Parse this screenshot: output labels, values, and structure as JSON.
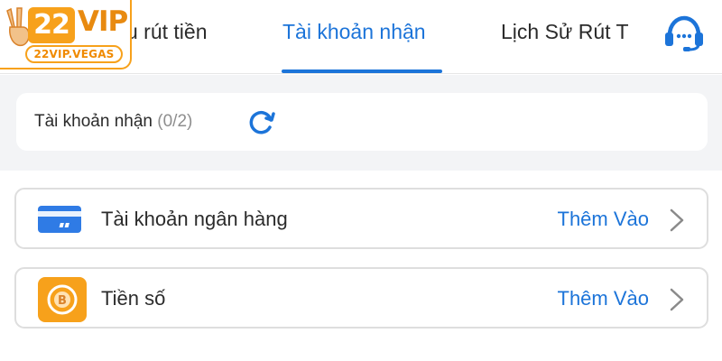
{
  "logo": {
    "badge": "22",
    "text": "VIP",
    "domain": "22VIP.VEGAS"
  },
  "tabs": [
    {
      "label": "u rút tiền",
      "active": false
    },
    {
      "label": "Tài khoản nhận",
      "active": true
    },
    {
      "label": "Lịch Sử Rút T",
      "active": false
    }
  ],
  "support_icon": "headset-icon",
  "summary": {
    "label": "Tài khoản nhận",
    "count": "(0/2)",
    "icon": "refresh-icon"
  },
  "accounts": [
    {
      "label": "Tài khoản ngân hàng",
      "action": "Thêm Vào",
      "icon": "bank-card-icon"
    },
    {
      "label": "Tiền số",
      "action": "Thêm Vào",
      "icon": "bitcoin-icon"
    }
  ],
  "colors": {
    "accent": "#1c74d9",
    "brand": "#f7a11b",
    "background": "#f3f4f6"
  }
}
